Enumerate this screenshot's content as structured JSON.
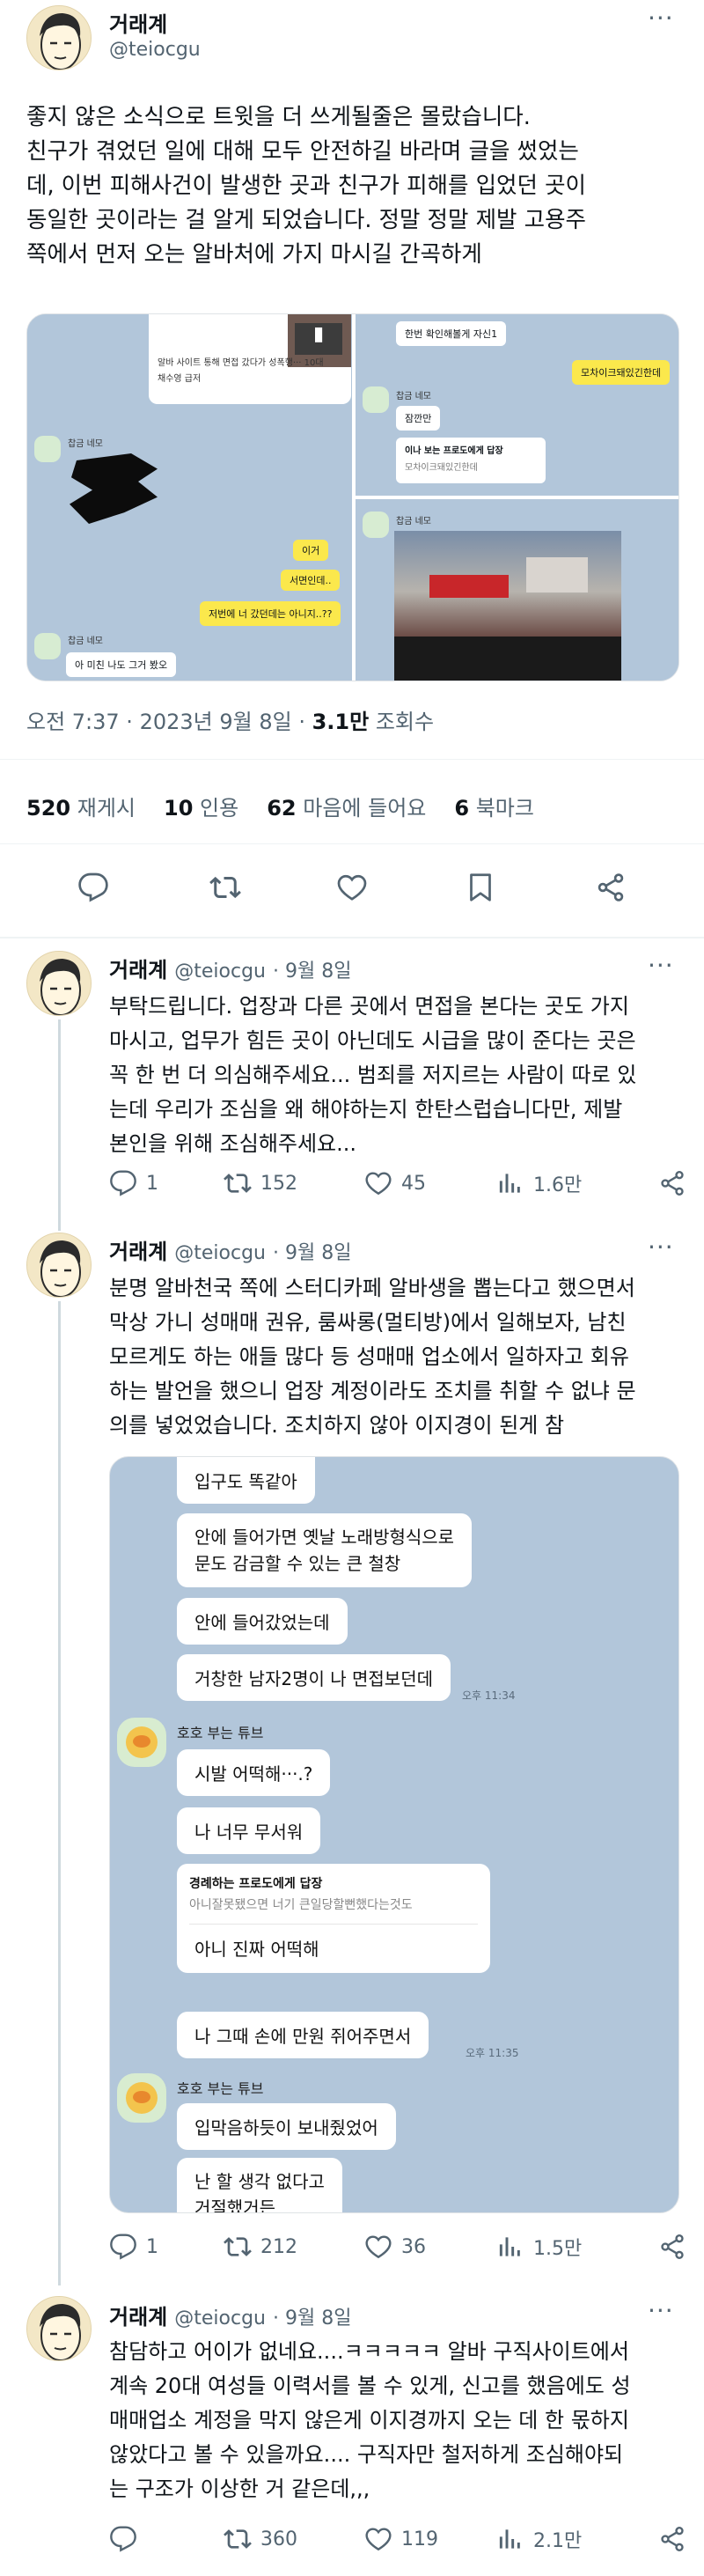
{
  "main_tweet": {
    "name": "거래계",
    "handle": "@teiocgu",
    "text_lines": [
      "좋지 않은 소식으로 트윗을 더 쓰게될줄은 몰랐습니다.",
      "친구가 겪었던 일에 대해 모두 안전하길 바라며 글을 썼었는",
      "데, 이번 피해사건이 발생한 곳과 친구가 피해를 입었던 곳이",
      "동일한 곳이라는 걸 알게 되었습니다. 정말 정말 제발 고용주",
      "쪽에서 먼저 오는 알바처에 가지 마시길 간곡하게"
    ],
    "meta_prefix": "오전 7:37 · 2023년 9월 8일 · ",
    "views_count": "3.1만",
    "views_label": " 조회수",
    "stats": [
      {
        "num": "520",
        "label": "재게시"
      },
      {
        "num": "10",
        "label": "인용"
      },
      {
        "num": "62",
        "label": "마음에 들어요"
      },
      {
        "num": "6",
        "label": "북마크"
      }
    ],
    "media": {
      "topleft_card_line1": "알바 사이트 통해 면접 갔다가 성폭행··· 10대",
      "topleft_card_line2": "채수영 급저",
      "sender_1": "찹금 네모",
      "yellow_1": "이거",
      "yellow_2": "서면인데..",
      "yellow_3": "저번에 너 갔던데는 아니지..??",
      "white_bottom": "아 미친 나도 그거 봤오",
      "tr_bubble": "한번 확인해볼게 자신1",
      "tr_yellow": "모차이크돼있긴한데",
      "tr_sender": "찹금 네모",
      "tr_reply": "잠깐만",
      "tr_quote_title": "이나 보는 프로도에게 답장",
      "tr_quote_text": "모차이크돼있긴한데",
      "br_sender": "찹금 네모"
    }
  },
  "replies": [
    {
      "name": "거래계",
      "handle": "@teiocgu",
      "date": "· 9월 8일",
      "text_lines": [
        "부탁드립니다. 업장과 다른 곳에서 면접을 본다는 곳도 가지",
        "마시고, 업무가 힘든 곳이 아닌데도 시급을 많이 준다는 곳은",
        "꼭 한 번 더 의심해주세요... 범죄를 저지르는 사람이 따로 있",
        "는데 우리가 조심을 왜 해야하는지 한탄스럽습니다만, 제발",
        "본인을 위해 조심해주세요..."
      ],
      "reply_count": "1",
      "retweet_count": "152",
      "like_count": "45",
      "view_count": "1.6만"
    },
    {
      "name": "거래계",
      "handle": "@teiocgu",
      "date": "· 9월 8일",
      "text_lines": [
        "분명 알바천국 쪽에 스터디카페 알바생을 뽑는다고 했으면서",
        "막상 가니 성매매 권유, 룸싸롱(멀티방)에서 일해보자, 남친",
        "모르게도 하는 애들 많다 등 성매매 업소에서 일하자고 회유",
        "하는 발언을 했으니 업장 계정이라도 조치를 취할 수 없냐 문",
        "의를 넣었었습니다. 조치하지 않아 이지경이 된게 참"
      ],
      "chat": {
        "b1": "입구도 똑같아",
        "b2_l1": "안에 들어가면 옛날 노래방형식으로",
        "b2_l2": "문도 감금할 수 있는 큰 철창",
        "b3": "안에 들어갔었는데",
        "b4": "거창한 남자2명이 나 면접보던데",
        "t1": "오후 11:34",
        "sender": "호호 부는 튜브",
        "b5": "시발 어떡해···.?",
        "b6": "나 너무 무서워",
        "quote_title": "경례하는 프로도에게 답장",
        "quote_text": "아니잘못됐으면 너기 큰일당할뻔했다는것도",
        "b7": "아니 진짜 어떡해",
        "b8": "나 그때 손에 만원 쥐어주면서",
        "t2": "오후 11:35",
        "sender2": "호호 부는 튜브",
        "b9": "입막음하듯이 보내줬었어",
        "b10_l1": "난 할 생각 없다고",
        "b10_l2": "거절했거든"
      },
      "reply_count": "1",
      "retweet_count": "212",
      "like_count": "36",
      "view_count": "1.5만"
    },
    {
      "name": "거래계",
      "handle": "@teiocgu",
      "date": "· 9월 8일",
      "text_lines": [
        "참담하고 어이가 없네요....ㅋㅋㅋㅋㅋ 알바 구직사이트에서",
        "계속 20대 여성들 이력서를 볼 수 있게, 신고를 했음에도 성",
        "매매업소 계정을 막지 않은게 이지경까지 오는 데 한 몫하지",
        "않았다고 볼 수 있을까요.... 구직자만 철저하게 조심해야되",
        "는 구조가 이상한 거 같은데,,,"
      ],
      "reply_count": "",
      "retweet_count": "360",
      "like_count": "119",
      "view_count": "2.1만"
    }
  ],
  "icons": {
    "more": "more-icon",
    "reply": "reply-icon",
    "retweet": "retweet-icon",
    "like": "like-icon",
    "bookmark": "bookmark-icon",
    "share": "share-icon",
    "views": "views-icon"
  }
}
